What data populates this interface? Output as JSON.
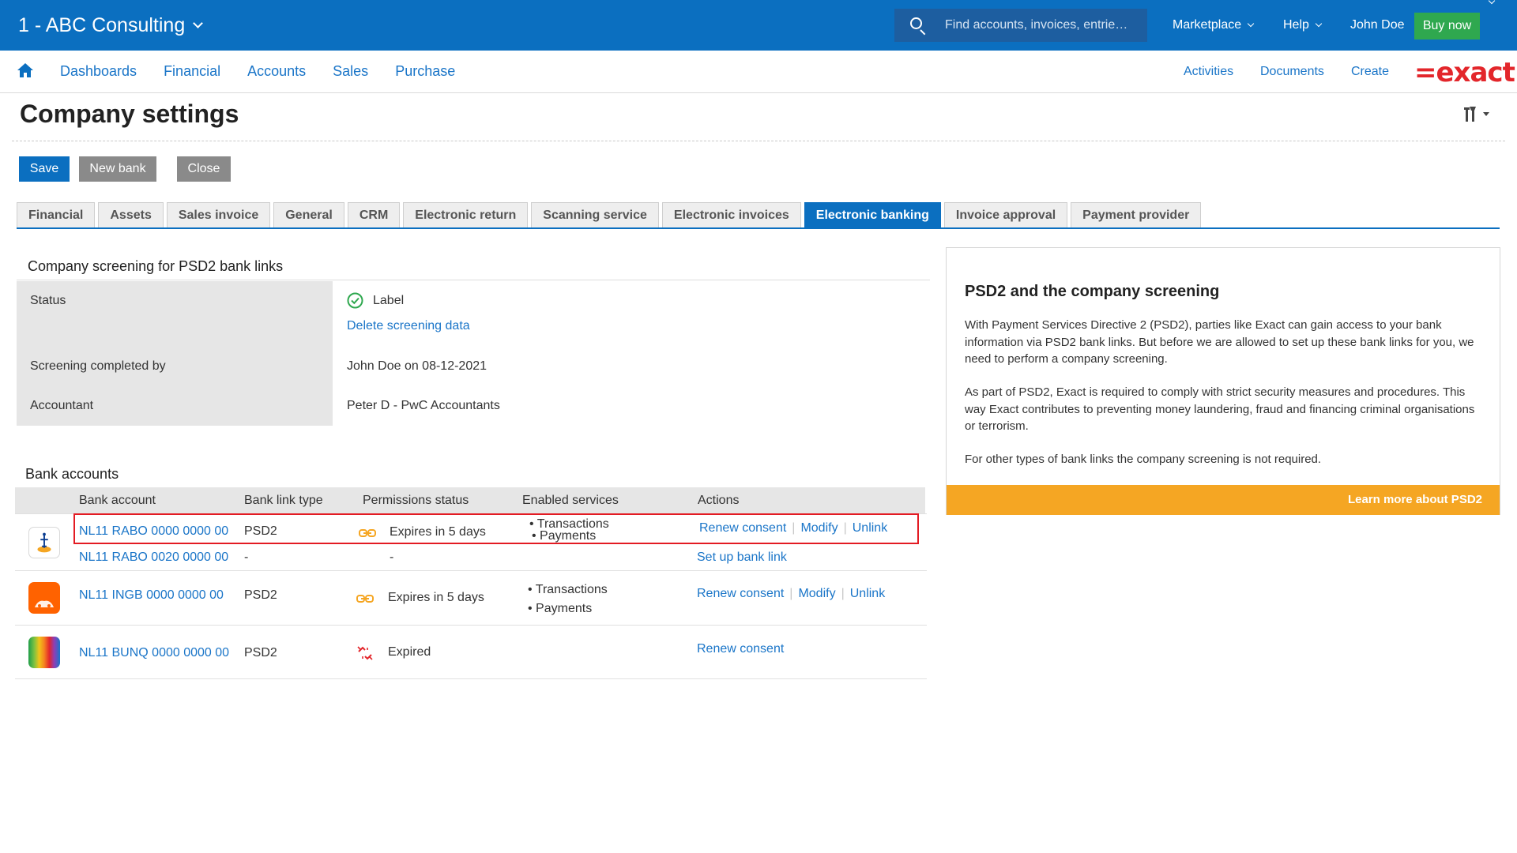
{
  "topbar": {
    "company": "1 - ABC Consulting",
    "search_placeholder": "Find accounts, invoices, entrie…",
    "marketplace": "Marketplace",
    "help": "Help",
    "user": "John Doe",
    "buy_now": "Buy now",
    "colors": {
      "bar": "#0b6fc0",
      "buy_now": "#2fa84f"
    }
  },
  "nav": {
    "items": [
      "Dashboards",
      "Financial",
      "Accounts",
      "Sales",
      "Purchase"
    ],
    "right": [
      "Activities",
      "Documents",
      "Create"
    ],
    "logo": "=exact"
  },
  "page": {
    "title": "Company settings"
  },
  "buttons": {
    "save": "Save",
    "new_bank": "New bank",
    "close": "Close"
  },
  "tabs": [
    {
      "label": "Financial",
      "active": false
    },
    {
      "label": "Assets",
      "active": false
    },
    {
      "label": "Sales invoice",
      "active": false
    },
    {
      "label": "General",
      "active": false
    },
    {
      "label": "CRM",
      "active": false
    },
    {
      "label": "Electronic return",
      "active": false
    },
    {
      "label": "Scanning service",
      "active": false
    },
    {
      "label": "Electronic invoices",
      "active": false
    },
    {
      "label": "Electronic banking",
      "active": true
    },
    {
      "label": "Invoice approval",
      "active": false
    },
    {
      "label": "Payment provider",
      "active": false
    }
  ],
  "screening": {
    "title": "Company screening for PSD2 bank links",
    "status_label": "Status",
    "status_value": "Label",
    "delete_link": "Delete screening data",
    "completed_label": "Screening completed by",
    "completed_value": "John Doe on 08-12-2021",
    "accountant_label": "Accountant",
    "accountant_value": "Peter D - PwC Accountants"
  },
  "bank": {
    "title": "Bank accounts",
    "columns": [
      "Bank account",
      "Bank link type",
      "Permissions status",
      "Enabled services",
      "Actions"
    ],
    "rows": [
      {
        "bank": "rabo",
        "account": "NL11 RABO 0000 0000 00",
        "type": "PSD2",
        "status": "Expires in 5 days",
        "status_icon": "link-icon",
        "services": [
          "• Transactions",
          "• Payments"
        ],
        "actions": [
          "Renew consent",
          "Modify",
          "Unlink"
        ]
      },
      {
        "bank": "rabo",
        "account": "NL11 RABO 0020 0000 00",
        "type": "-",
        "status": "-",
        "services": [],
        "actions": [
          "Set up bank link"
        ]
      },
      {
        "bank": "ing",
        "account": "NL11 INGB 0000 0000 00",
        "type": "PSD2",
        "status": "Expires in 5 days",
        "status_icon": "link-icon",
        "services": [
          "• Transactions",
          "• Payments"
        ],
        "actions": [
          "Renew consent",
          "Modify",
          "Unlink"
        ]
      },
      {
        "bank": "bunq",
        "account": "NL11 BUNQ 0000 0000 00",
        "type": "PSD2",
        "status": "Expired",
        "status_icon": "broken-link-icon",
        "services": [],
        "actions": [
          "Renew consent"
        ]
      }
    ]
  },
  "info": {
    "title": "PSD2 and the company screening",
    "p1": "With Payment Services Directive 2 (PSD2), parties like Exact can gain access to your bank information via PSD2 bank links. But before we are allowed to set up these bank links for you, we need to perform a company screening.",
    "p2": "As part of PSD2, Exact is required to comply with strict security measures and procedures. This way Exact contributes to preventing money laundering, fraud and financing criminal organisations or terrorism.",
    "p3": "For other types of bank links the company screening is not required.",
    "cta": "Learn more about PSD2"
  }
}
